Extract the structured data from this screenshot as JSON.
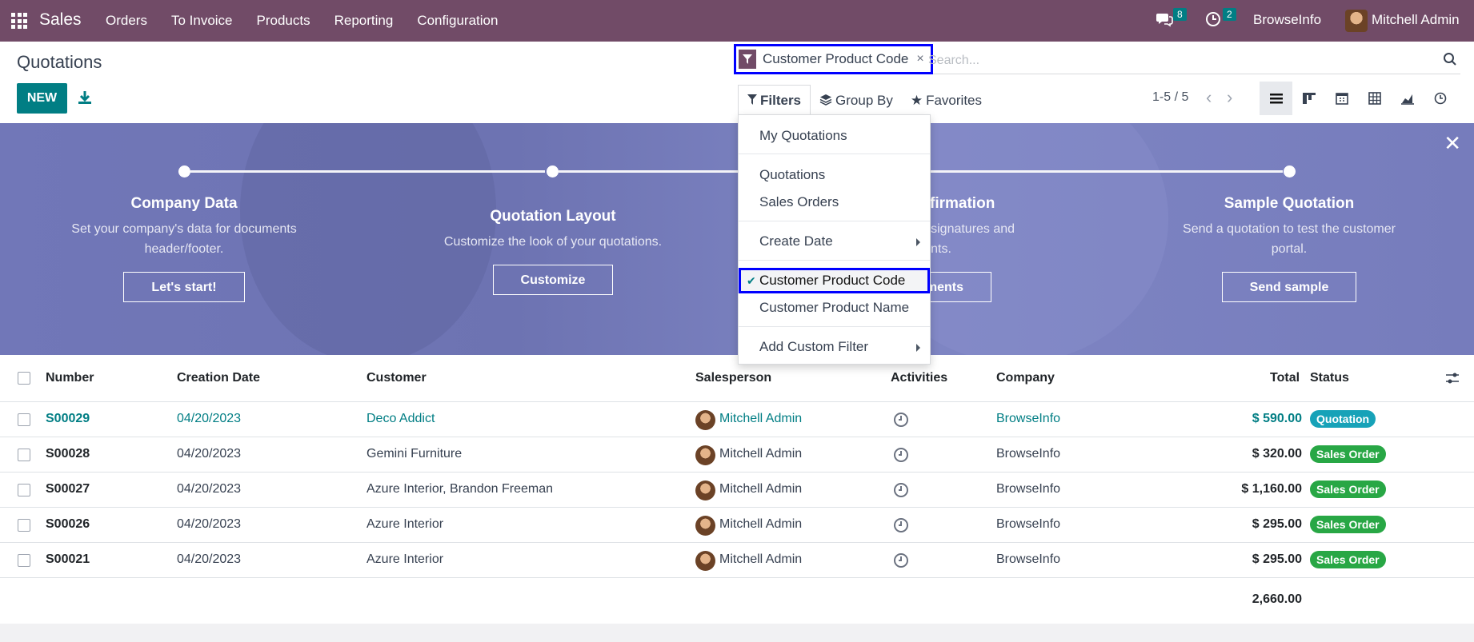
{
  "navbar": {
    "brand": "Sales",
    "menu": [
      "Orders",
      "To Invoice",
      "Products",
      "Reporting",
      "Configuration"
    ],
    "messages_count": "8",
    "activities_count": "2",
    "company": "BrowseInfo",
    "user": "Mitchell Admin"
  },
  "control": {
    "title": "Quotations",
    "new_label": "NEW",
    "facet_label": "Customer Product Code",
    "facet_close": "×",
    "search_placeholder": "Search...",
    "tabs": {
      "filters": "Filters",
      "group_by": "Group By",
      "favorites": "Favorites"
    },
    "pager": "1-5 / 5"
  },
  "banner": {
    "steps": [
      {
        "title": "Company Data",
        "desc": "Set your company's data for documents header/footer.",
        "button": "Let's start!"
      },
      {
        "title": "Quotation Layout",
        "desc": "Customize the look of your quotations.",
        "button": "Customize"
      },
      {
        "title": "Online Confirmation",
        "desc": "Enable electronic signatures and payments.",
        "button": "Set payments"
      },
      {
        "title": "Sample Quotation",
        "desc": "Send a quotation to test the customer portal.",
        "button": "Send sample"
      }
    ]
  },
  "filters_menu": {
    "items": [
      "My Quotations",
      "Quotations",
      "Sales Orders",
      "Create Date",
      "Customer Product Code",
      "Customer Product Name",
      "Add Custom Filter"
    ],
    "selected": "Customer Product Code"
  },
  "table": {
    "headers": [
      "Number",
      "Creation Date",
      "Customer",
      "Salesperson",
      "Activities",
      "Company",
      "Total",
      "Status"
    ],
    "rows": [
      {
        "number": "S00029",
        "date": "04/20/2023",
        "customer": "Deco Addict",
        "salesperson": "Mitchell Admin",
        "company": "BrowseInfo",
        "total": "$ 590.00",
        "status": "Quotation"
      },
      {
        "number": "S00028",
        "date": "04/20/2023",
        "customer": "Gemini Furniture",
        "salesperson": "Mitchell Admin",
        "company": "BrowseInfo",
        "total": "$ 320.00",
        "status": "Sales Order"
      },
      {
        "number": "S00027",
        "date": "04/20/2023",
        "customer": "Azure Interior, Brandon Freeman",
        "salesperson": "Mitchell Admin",
        "company": "BrowseInfo",
        "total": "$ 1,160.00",
        "status": "Sales Order"
      },
      {
        "number": "S00026",
        "date": "04/20/2023",
        "customer": "Azure Interior",
        "salesperson": "Mitchell Admin",
        "company": "BrowseInfo",
        "total": "$ 295.00",
        "status": "Sales Order"
      },
      {
        "number": "S00021",
        "date": "04/20/2023",
        "customer": "Azure Interior",
        "salesperson": "Mitchell Admin",
        "company": "BrowseInfo",
        "total": "$ 295.00",
        "status": "Sales Order"
      }
    ],
    "grand_total": "2,660.00"
  },
  "colors": {
    "brand": "#714b67",
    "accent": "#017e84",
    "quotation_badge": "#17a2b8",
    "sales_order_badge": "#28a745",
    "highlight": "#0000ff"
  }
}
